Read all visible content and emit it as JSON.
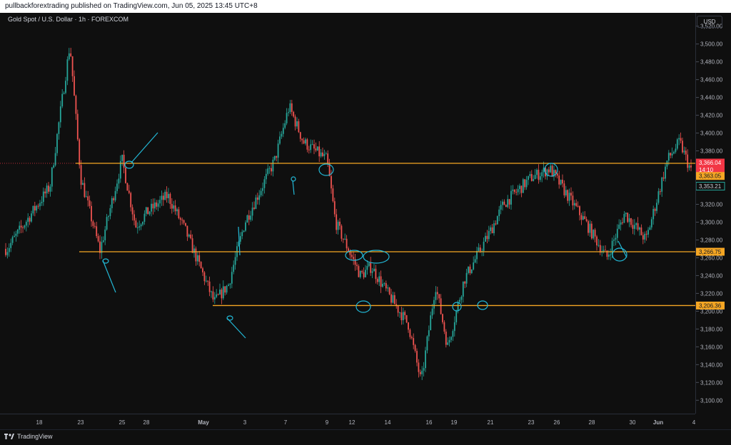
{
  "header": {
    "publish_line": "pullbackforextrading published on TradingView.com, Jun 05, 2025 13:45 UTC+8"
  },
  "legend": {
    "symbol_title": "Gold Spot / U.S. Dollar · 1h · FOREXCOM"
  },
  "price_scale": {
    "currency": "USD"
  },
  "footer": {
    "brand": "TradingView"
  },
  "colors": {
    "up": "#26a69a",
    "down": "#ef5350",
    "level": "#f5a623",
    "annotation": "#22b8d6",
    "current": "#f23645"
  },
  "chart_data": {
    "type": "candlestick",
    "title": "Gold Spot / U.S. Dollar · 1h · FOREXCOM",
    "ylim": [
      3085,
      3535
    ],
    "y_ticks": [
      3100,
      3120,
      3140,
      3160,
      3180,
      3200,
      3220,
      3240,
      3260,
      3280,
      3300,
      3320,
      3340,
      3360,
      3380,
      3400,
      3420,
      3440,
      3460,
      3480,
      3500,
      3520
    ],
    "x_ticks": [
      "18",
      "23",
      "25",
      "28",
      "May",
      "3",
      "7",
      "9",
      "12",
      "14",
      "16",
      "19",
      "21",
      "23",
      "26",
      "28",
      "30",
      "Jun",
      "4"
    ],
    "grid": false,
    "horizontal_levels": [
      3366.04,
      3266.75,
      3206.36
    ],
    "price_labels": [
      {
        "text": "3,366.04",
        "kind": "current"
      },
      {
        "text": "14:10",
        "kind": "countdown"
      },
      {
        "text": "3,363.05",
        "kind": "level"
      },
      {
        "text": "3,353.21",
        "kind": "last"
      },
      {
        "text": "3,266.75",
        "kind": "level"
      },
      {
        "text": "3,206.36",
        "kind": "level"
      }
    ],
    "price_path": [
      [
        "18",
        3270
      ],
      [
        "19",
        3340
      ],
      [
        "22",
        3500
      ],
      [
        "23",
        3350
      ],
      [
        "24",
        3268
      ],
      [
        "25",
        3370
      ],
      [
        "26",
        3295
      ],
      [
        "27",
        3310
      ],
      [
        "28",
        3330
      ],
      [
        "29",
        3290
      ],
      [
        "30",
        3260
      ],
      [
        "May",
        3210
      ],
      [
        "2",
        3230
      ],
      [
        "3",
        3300
      ],
      [
        "6",
        3370
      ],
      [
        "7",
        3430
      ],
      [
        "8",
        3390
      ],
      [
        "9",
        3370
      ],
      [
        "10",
        3300
      ],
      [
        "12",
        3240
      ],
      [
        "13",
        3250
      ],
      [
        "14",
        3220
      ],
      [
        "15",
        3185
      ],
      [
        "16",
        3120
      ],
      [
        "17",
        3230
      ],
      [
        "19",
        3160
      ],
      [
        "20",
        3235
      ],
      [
        "21",
        3290
      ],
      [
        "22",
        3320
      ],
      [
        "23",
        3350
      ],
      [
        "26",
        3360
      ],
      [
        "27",
        3330
      ],
      [
        "28",
        3300
      ],
      [
        "29",
        3260
      ],
      [
        "30",
        3310
      ],
      [
        "Jun",
        3280
      ],
      [
        "2",
        3370
      ],
      [
        "3",
        3390
      ],
      [
        "4",
        3353
      ]
    ]
  }
}
